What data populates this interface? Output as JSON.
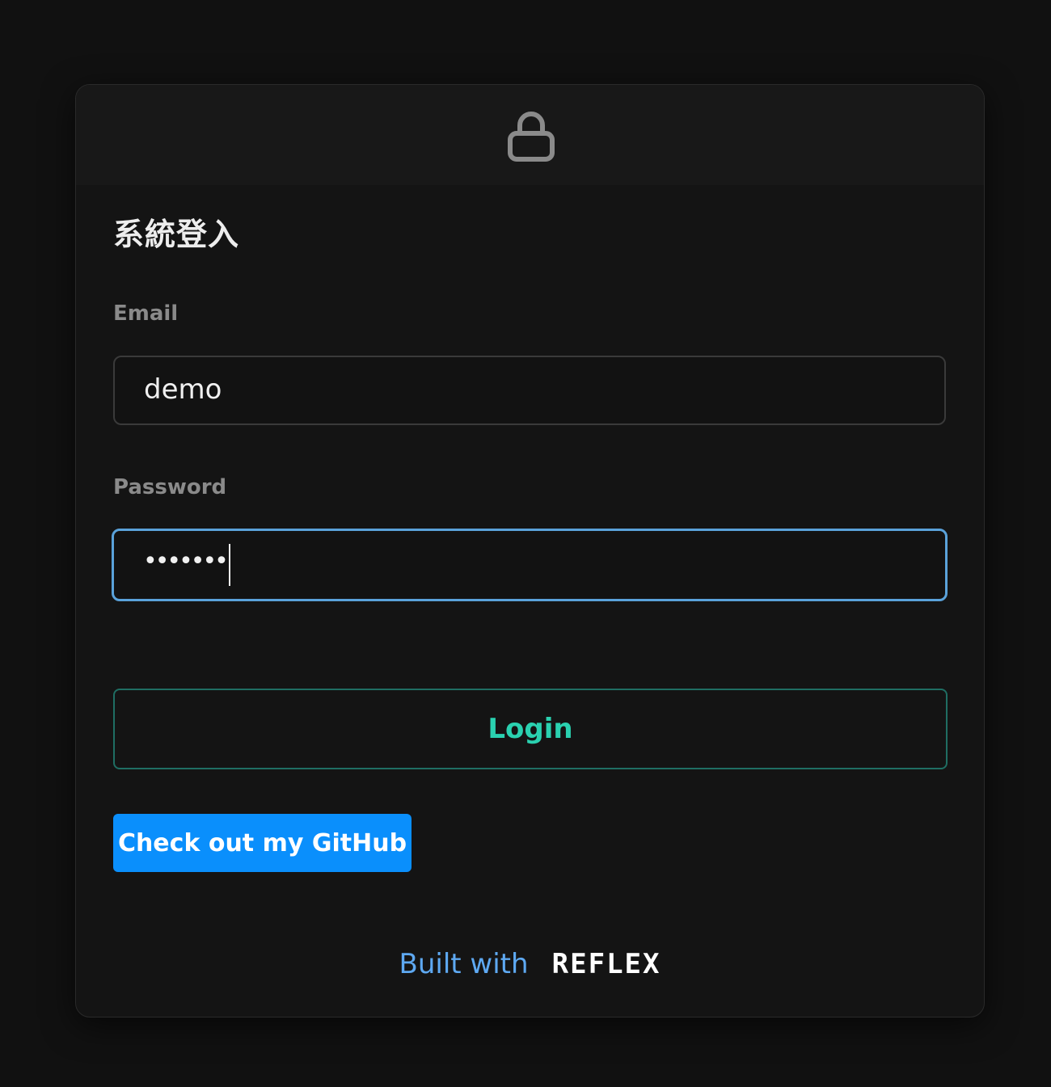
{
  "login_card": {
    "icon": "lock-icon",
    "title": "系統登入",
    "email": {
      "label": "Email",
      "value": "demo"
    },
    "password": {
      "label": "Password",
      "value": "•••••••",
      "focused": true
    },
    "login_button_label": "Login",
    "github_button_label": "Check out my GitHub",
    "footer": {
      "built_with": "Built with",
      "logo_text": "REFLEX"
    }
  },
  "colors": {
    "background": "#111111",
    "card": "#141414",
    "accent_teal": "#2ad1b0",
    "focus_blue": "#5aa2da",
    "github_blue": "#0a8ffc",
    "footer_link": "#5ea9f2"
  }
}
